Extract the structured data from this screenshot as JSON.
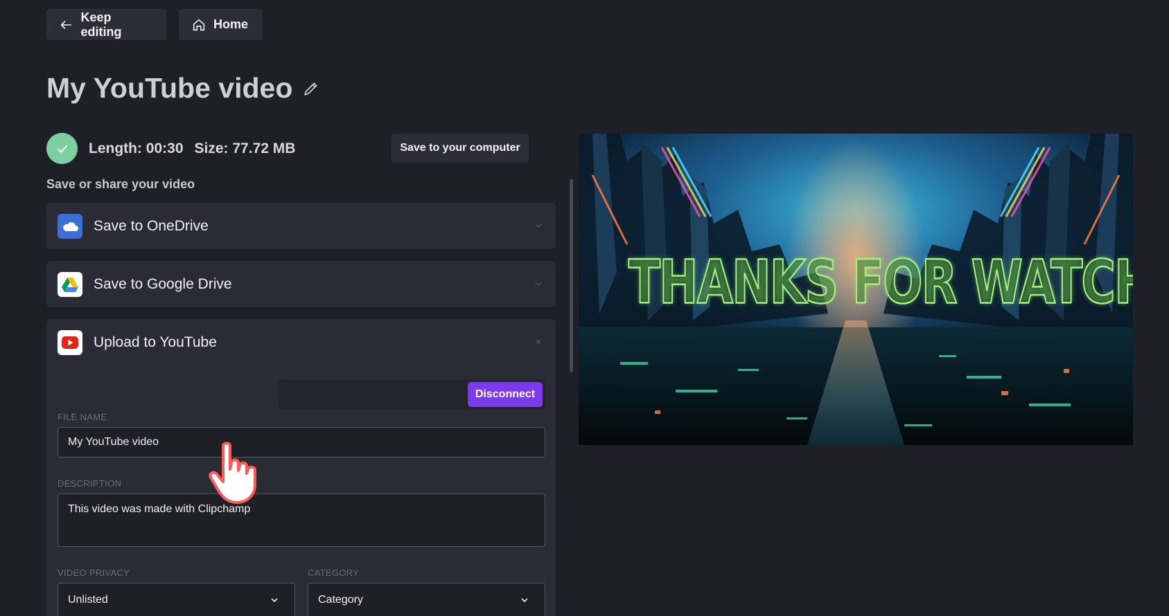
{
  "top_nav": {
    "keep_editing_label": "Keep editing",
    "home_label": "Home"
  },
  "project": {
    "title": "My YouTube video"
  },
  "export_status": {
    "length_text": "Length: 00:30",
    "size_text": "Size: 77.72 MB",
    "save_computer_label": "Save to your computer"
  },
  "share": {
    "heading": "Save or share your video",
    "options": [
      {
        "label": "Save to OneDrive",
        "icon": "onedrive-icon",
        "expanded": false
      },
      {
        "label": "Save to Google Drive",
        "icon": "google-drive-icon",
        "expanded": false
      },
      {
        "label": "Upload to YouTube",
        "icon": "youtube-icon",
        "expanded": true
      }
    ]
  },
  "youtube_form": {
    "disconnect_label": "Disconnect",
    "file_name_label": "FILE NAME",
    "file_name_value": "My YouTube video",
    "description_label": "DESCRIPTION",
    "description_value": "This video was made with Clipchamp",
    "privacy_label": "VIDEO PRIVACY",
    "privacy_value": "Unlisted",
    "category_label": "CATEGORY",
    "category_value": "Category"
  },
  "preview": {
    "overlay_text": "THANKS FOR WATCHING"
  },
  "colors": {
    "accent": "#7c3aed",
    "success": "#7ccfa0",
    "background": "#1f1f27",
    "panel": "#2b2b35"
  }
}
